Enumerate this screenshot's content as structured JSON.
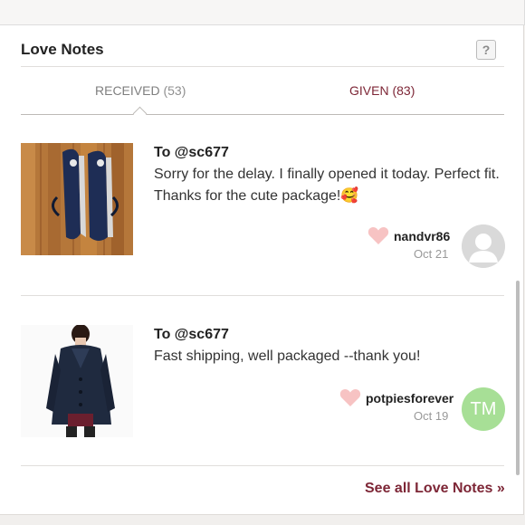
{
  "widget": {
    "title": "Love Notes",
    "help_label": "?"
  },
  "tabs": [
    {
      "label": "RECEIVED",
      "count": "(53)"
    },
    {
      "label": "GIVEN",
      "count": "(83)"
    }
  ],
  "notes": [
    {
      "to": "To @sc677",
      "message": "Sorry for the delay. I finally opened it today. Perfect fit. Thanks for the cute package!🥰",
      "username": "nandvr86",
      "date": "Oct 21",
      "item_image": "navy-sneakers-photo",
      "avatar": "default-user-avatar"
    },
    {
      "to": "To @sc677",
      "message": "Fast shipping, well packaged --thank you!",
      "username": "potpiesforever",
      "date": "Oct 19",
      "item_image": "navy-jacket-photo",
      "avatar_initials": "TM"
    }
  ],
  "footer": {
    "see_all": "See all Love Notes »"
  },
  "colors": {
    "accent": "#7d2636",
    "heart": "#f7c3c3",
    "avatar_tm": "#a7df96"
  }
}
